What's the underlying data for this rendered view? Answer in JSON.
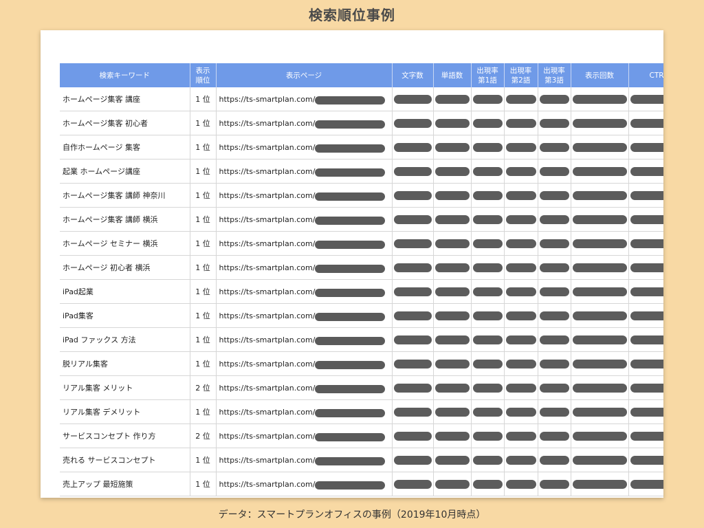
{
  "page_title": "検索順位事例",
  "table": {
    "headers": {
      "keyword": "検索キーワード",
      "rank": "表示\n順位",
      "page": "表示ページ",
      "chars": "文字数",
      "words": "単語数",
      "freq1": "出現率\n第1語",
      "freq2": "出現率\n第2語",
      "freq3": "出現率\n第3語",
      "impressions": "表示回数",
      "ctr": "CTR"
    },
    "rows": [
      {
        "keyword": "ホームページ集客 講座",
        "rank": "1 位",
        "url": "https://ts-smartplan.com/"
      },
      {
        "keyword": "ホームページ集客 初心者",
        "rank": "1 位",
        "url": "https://ts-smartplan.com/"
      },
      {
        "keyword": "自作ホームページ 集客",
        "rank": "1 位",
        "url": "https://ts-smartplan.com/"
      },
      {
        "keyword": "起業 ホームページ講座",
        "rank": "1 位",
        "url": "https://ts-smartplan.com/"
      },
      {
        "keyword": "ホームページ集客 講師 神奈川",
        "rank": "1 位",
        "url": "https://ts-smartplan.com/"
      },
      {
        "keyword": "ホームページ集客 講師 横浜",
        "rank": "1 位",
        "url": "https://ts-smartplan.com/"
      },
      {
        "keyword": "ホームページ セミナー 横浜",
        "rank": "1 位",
        "url": "https://ts-smartplan.com/"
      },
      {
        "keyword": "ホームページ 初心者 横浜",
        "rank": "1 位",
        "url": "https://ts-smartplan.com/"
      },
      {
        "keyword": "iPad起業",
        "rank": "1 位",
        "url": "https://ts-smartplan.com/"
      },
      {
        "keyword": "iPad集客",
        "rank": "1 位",
        "url": "https://ts-smartplan.com/"
      },
      {
        "keyword": "iPad ファックス 方法",
        "rank": "1 位",
        "url": "https://ts-smartplan.com/"
      },
      {
        "keyword": "脱リアル集客",
        "rank": "1 位",
        "url": "https://ts-smartplan.com/"
      },
      {
        "keyword": "リアル集客 メリット",
        "rank": "2 位",
        "url": "https://ts-smartplan.com/"
      },
      {
        "keyword": "リアル集客 デメリット",
        "rank": "1 位",
        "url": "https://ts-smartplan.com/"
      },
      {
        "keyword": "サービスコンセプト 作り方",
        "rank": "2 位",
        "url": "https://ts-smartplan.com/"
      },
      {
        "keyword": "売れる サービスコンセプト",
        "rank": "1 位",
        "url": "https://ts-smartplan.com/"
      },
      {
        "keyword": "売上アップ 最短施策",
        "rank": "1 位",
        "url": "https://ts-smartplan.com/"
      }
    ]
  },
  "source_note": "データ：スマートプランオフィスの事例（2019年10月時点）",
  "colors": {
    "background": "#f8d9a4",
    "header": "#6f9ae8",
    "mask": "#5c5c5c"
  }
}
